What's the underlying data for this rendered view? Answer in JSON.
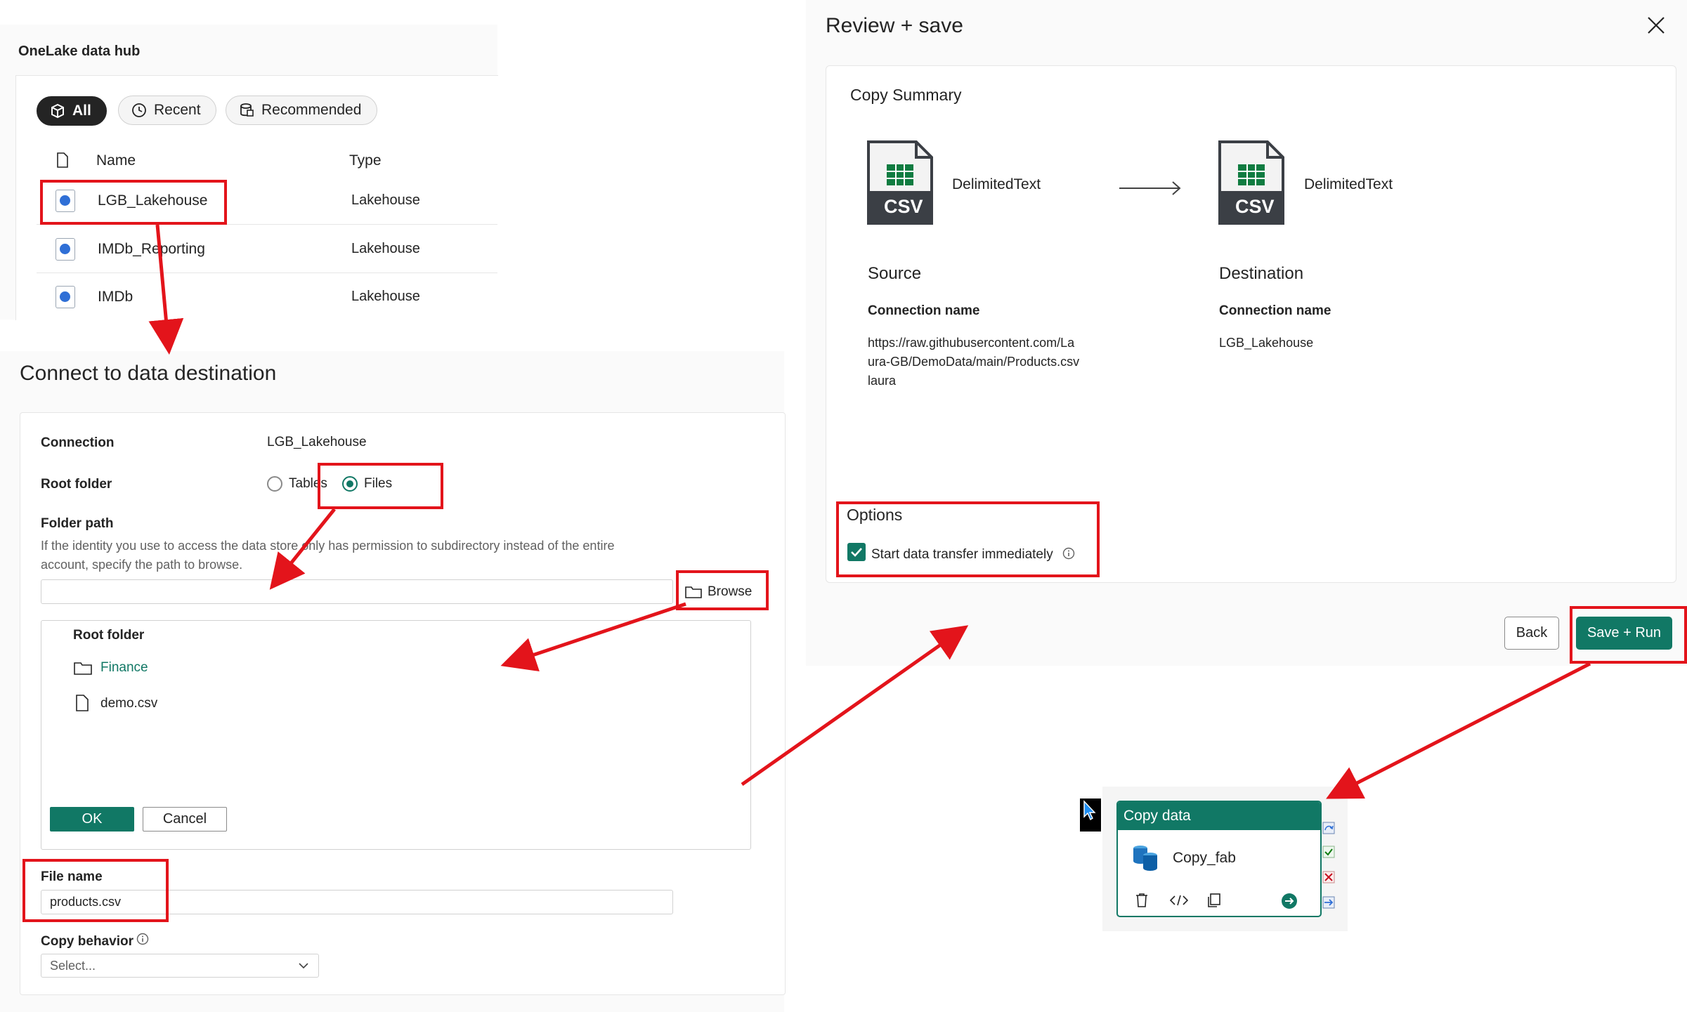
{
  "onelake": {
    "title": "OneLake data hub",
    "filters": [
      {
        "label": "All",
        "icon": "cube-icon"
      },
      {
        "label": "Recent",
        "icon": "clock-icon"
      },
      {
        "label": "Recommended",
        "icon": "database-icon"
      }
    ],
    "columns": {
      "name": "Name",
      "type": "Type"
    },
    "rows": [
      {
        "name": "LGB_Lakehouse",
        "type": "Lakehouse"
      },
      {
        "name": "IMDb_Reporting",
        "type": "Lakehouse"
      },
      {
        "name": "IMDb",
        "type": "Lakehouse"
      }
    ]
  },
  "connect": {
    "title": "Connect to data destination",
    "connection_label": "Connection",
    "connection_value": "LGB_Lakehouse",
    "root_folder_label": "Root folder",
    "option_tables": "Tables",
    "option_files": "Files",
    "folder_path_label": "Folder path",
    "folder_path_help_1": "If the identity you use to access the data store only has permission to subdirectory instead of the entire",
    "folder_path_help_2": "account, specify the path to browse.",
    "browse_label": "Browse",
    "tree_root": "Root folder",
    "tree_items": [
      {
        "label": "Finance",
        "icon": "folder-icon"
      },
      {
        "label": "demo.csv",
        "icon": "file-icon"
      }
    ],
    "ok_label": "OK",
    "cancel_label": "Cancel",
    "file_name_label": "File name",
    "file_name_value": "products.csv",
    "copy_behavior_label": "Copy behavior",
    "copy_behavior_placeholder": "Select..."
  },
  "review": {
    "title": "Review + save",
    "summary_title": "Copy Summary",
    "source_format": "DelimitedText",
    "dest_format": "DelimitedText",
    "csv_label": "CSV",
    "source_heading": "Source",
    "dest_heading": "Destination",
    "connection_name_label": "Connection name",
    "source_conn_1": "https://raw.githubusercontent.com/La",
    "source_conn_2": "ura-GB/DemoData/main/Products.csv",
    "source_conn_3": "laura",
    "dest_conn": "LGB_Lakehouse",
    "options_title": "Options",
    "start_transfer_label": "Start data transfer immediately",
    "back_label": "Back",
    "save_run_label": "Save + Run"
  },
  "activity": {
    "header": "Copy data",
    "name": "Copy_fab"
  },
  "colors": {
    "accent": "#117865",
    "annotation": "#e3141b"
  }
}
